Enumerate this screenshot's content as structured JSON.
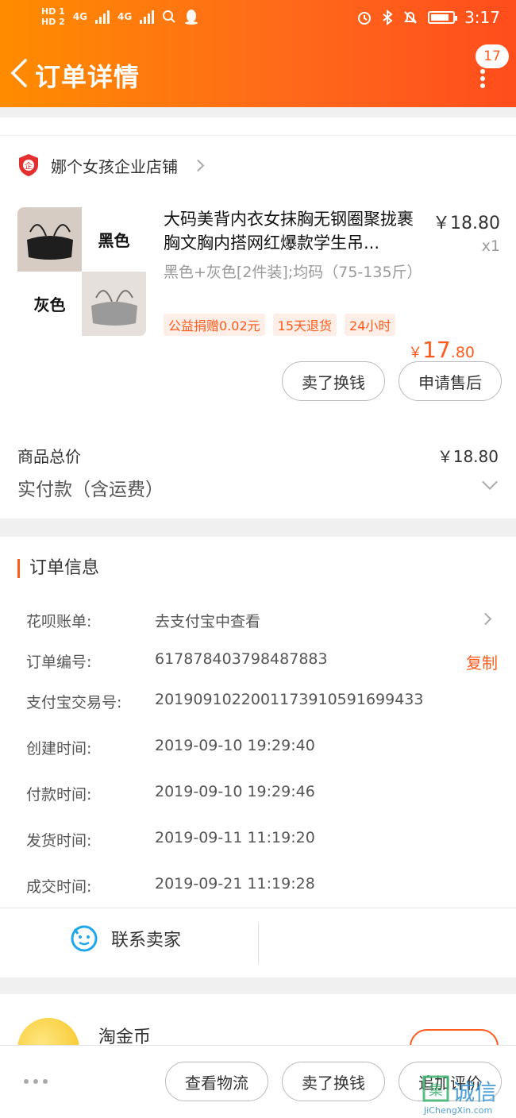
{
  "status_bar": {
    "network_left": [
      "HD 1",
      "HD 2"
    ],
    "sig_labels": [
      "4G",
      "4G"
    ],
    "time": "3:17"
  },
  "header": {
    "title": "订单详情",
    "badge_count": "17"
  },
  "shop": {
    "name": "娜个女孩企业店铺"
  },
  "product": {
    "title": "大码美背内衣女抹胸无钢圈聚拢裹胸文胸内搭网红爆款学生吊...",
    "price": "￥18.80",
    "quantity": "x1",
    "sku": "黑色+灰色[2件装];均码（75-135斤）",
    "tags": [
      "公益捐赠0.02元",
      "15天退货",
      "24小时"
    ],
    "thumb_labels": [
      "黑色",
      "灰色"
    ]
  },
  "actions": {
    "sell_exchange": "卖了换钱",
    "after_sale": "申请售后"
  },
  "summary": {
    "goods_total_label": "商品总价",
    "goods_total_value": "￥18.80",
    "paid_label": "实付款（含运费）",
    "paid_currency": "￥",
    "paid_integer": "17",
    "paid_decimal": ".80"
  },
  "order_info": {
    "title": "订单信息",
    "rows": [
      {
        "label": "花呗账单:",
        "value": "去支付宝中查看"
      },
      {
        "label": "订单编号:",
        "value": "617878403798487883",
        "action": "复制"
      },
      {
        "label": "支付宝交易号:",
        "value": "2019091022001173910591699433"
      },
      {
        "label": "创建时间:",
        "value": "2019-09-10 19:29:40"
      },
      {
        "label": "付款时间:",
        "value": "2019-09-10 19:29:46"
      },
      {
        "label": "发货时间:",
        "value": "2019-09-11 11:19:20"
      },
      {
        "label": "成交时间:",
        "value": "2019-09-21 11:19:28"
      }
    ]
  },
  "contact": {
    "label": "联系卖家"
  },
  "coin": {
    "name": "淘金币"
  },
  "bottom_bar": {
    "logistics": "查看物流",
    "sell_exchange": "卖了换钱",
    "add_review": "追加评价"
  },
  "watermark": {
    "cn": "诚信",
    "en": "JiChengXin.com"
  },
  "colors": {
    "accent": "#ff5a1a",
    "header_start": "#ff8c00",
    "header_end": "#ff4d1c"
  }
}
